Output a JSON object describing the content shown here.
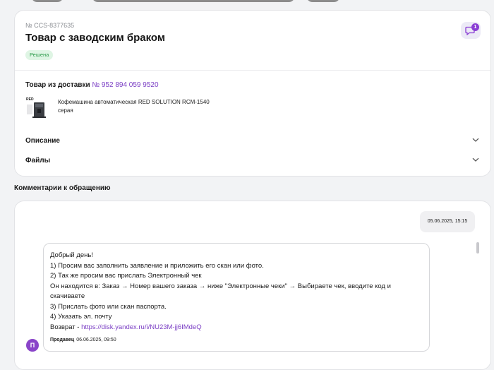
{
  "ticket": {
    "number": "№ CCS-8377635",
    "title": "Товар с заводским браком",
    "status": "Решена",
    "chat_badge_count": "1"
  },
  "delivery": {
    "label": "Товар из доставки",
    "link": "№ 952 894 059 9520"
  },
  "product": {
    "name": "Кофемашина автоматическая RED SOLUTION RCM-1540 серая"
  },
  "accordions": [
    {
      "label": "Описание"
    },
    {
      "label": "Файлы"
    }
  ],
  "comments": {
    "title": "Комментарии к обращению",
    "user_message_date": "05.06.2025, 15:15",
    "seller_avatar": "П",
    "seller_message": {
      "lines": [
        "Добрый день!",
        "1) Просим вас заполнить заявление и приложить его скан или фото.",
        "2) Так же просим вас прислать Электронный чек",
        "Он находится в: Заказ → Номер вашего заказа → ниже \"Электронные чеки\" → Выбираете чек, вводите код и скачиваете",
        "3) Прислать фото или скан паспорта.",
        "4) Указать эл. почту"
      ],
      "return_label": "Возврат - ",
      "return_link": "https://disk.yandex.ru/i/NU23M-jj6IMdeQ",
      "author": "Продавец",
      "date": "06.06.2025, 09:50"
    }
  },
  "colors": {
    "accent": "#7b3fc4",
    "status_bg": "#dff5e4",
    "status_text": "#2c9a4a",
    "avatar": "#8a45c9"
  }
}
